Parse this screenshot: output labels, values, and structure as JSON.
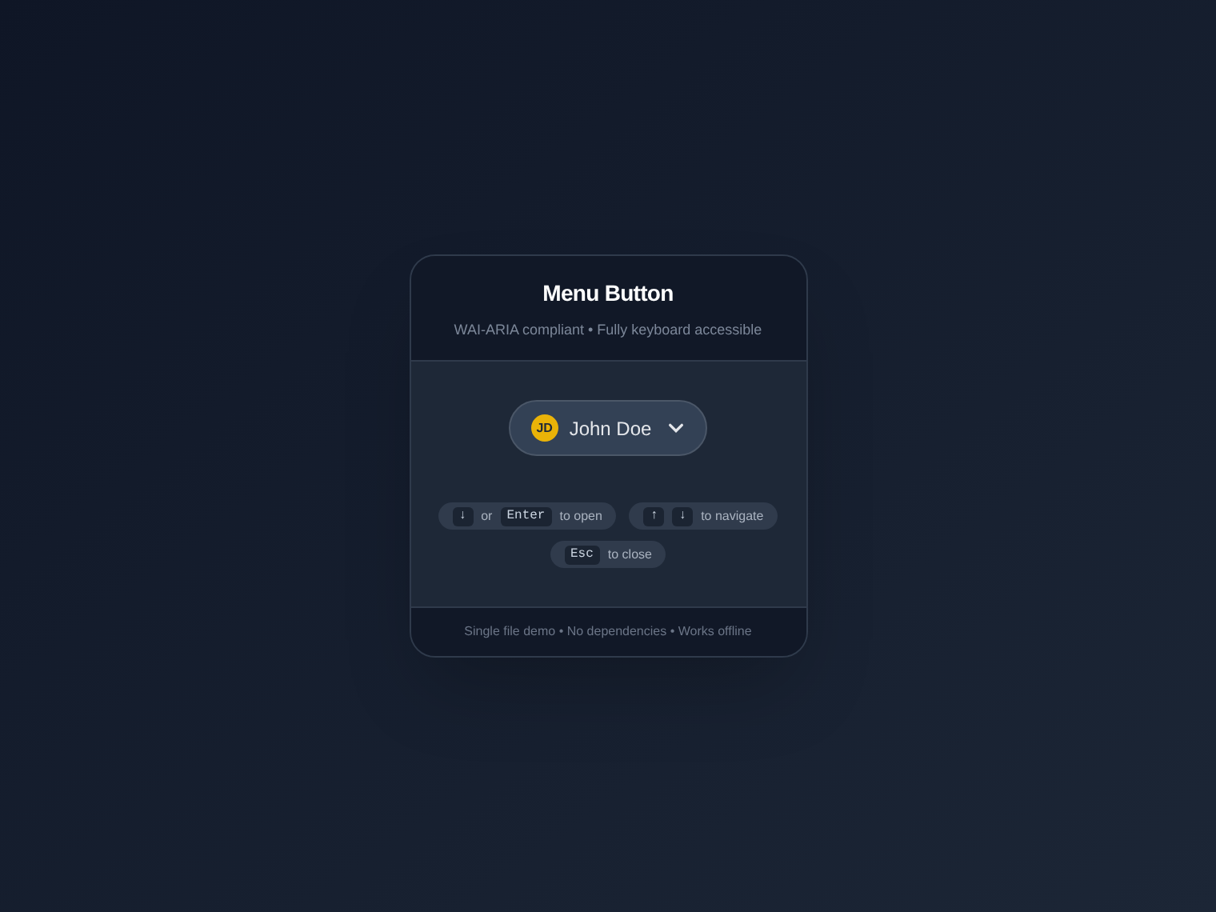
{
  "card": {
    "title": "Menu Button",
    "subtitle": "WAI-ARIA compliant • Fully keyboard accessible"
  },
  "menu_button": {
    "initials": "JD",
    "label": "John Doe",
    "expanded": false
  },
  "hints": [
    {
      "parts": [
        {
          "kind": "key",
          "text": "↓"
        },
        {
          "kind": "text",
          "text": "or"
        },
        {
          "kind": "key",
          "text": "Enter"
        },
        {
          "kind": "text",
          "text": "to open"
        }
      ]
    },
    {
      "parts": [
        {
          "kind": "key",
          "text": "↑"
        },
        {
          "kind": "key",
          "text": "↓"
        },
        {
          "kind": "text",
          "text": "to navigate"
        }
      ]
    },
    {
      "parts": [
        {
          "kind": "key",
          "text": "Esc"
        },
        {
          "kind": "text",
          "text": "to close"
        }
      ]
    }
  ],
  "footer": "Single file demo • No dependencies • Works offline"
}
